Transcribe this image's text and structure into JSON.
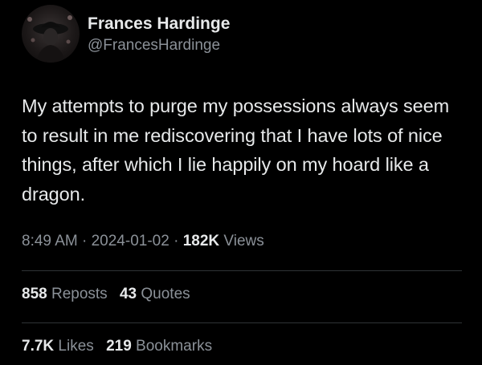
{
  "author": {
    "display_name": "Frances Hardinge",
    "handle": "@FrancesHardinge"
  },
  "tweet": {
    "text": "My attempts to purge my possessions always seem to result in me rediscovering that I have lots of nice things, after which I lie happily on my hoard like a dragon."
  },
  "meta": {
    "time": "8:49 AM",
    "separator": "·",
    "date": "2024-01-02",
    "views_count": "182K",
    "views_label": "Views"
  },
  "engagement": {
    "reposts_count": "858",
    "reposts_label": "Reposts",
    "quotes_count": "43",
    "quotes_label": "Quotes",
    "likes_count": "7.7K",
    "likes_label": "Likes",
    "bookmarks_count": "219",
    "bookmarks_label": "Bookmarks"
  },
  "colors": {
    "background": "#000000",
    "primary_text": "#e7e9ea",
    "secondary_text": "#8b9198",
    "divider": "#2f3336"
  }
}
